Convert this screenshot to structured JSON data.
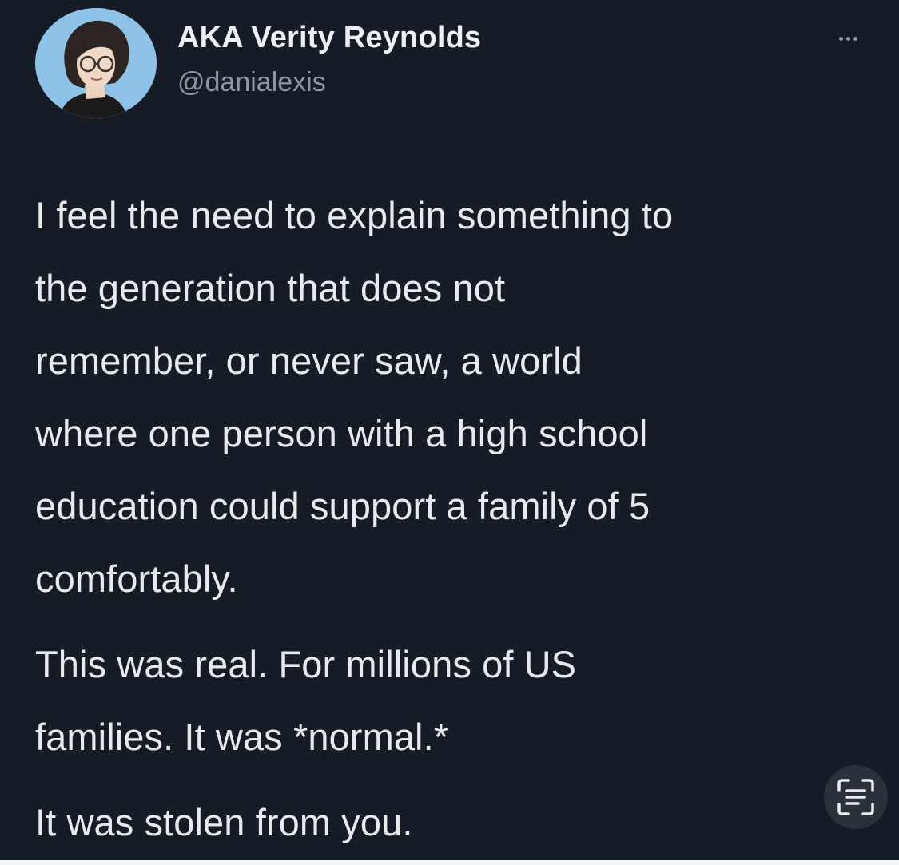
{
  "tweet": {
    "author": {
      "display_name": "AKA Verity Reynolds",
      "handle": "@danialexis"
    },
    "body_lines": [
      "I feel the need to explain something to",
      "the generation that does not",
      "remember, or never saw, a world",
      "where one person with a high school",
      "education could support a family of 5",
      "comfortably.",
      "This was real. For millions of US",
      "families. It was *normal.*",
      "It was stolen from you."
    ]
  },
  "icons": {
    "more": "more-horizontal-icon",
    "scan": "live-text-scan-icon"
  },
  "colors": {
    "background": "#161c26",
    "text": "#e8eaee",
    "secondary_text": "#8d96a3",
    "avatar_background": "#8ec2e6"
  }
}
